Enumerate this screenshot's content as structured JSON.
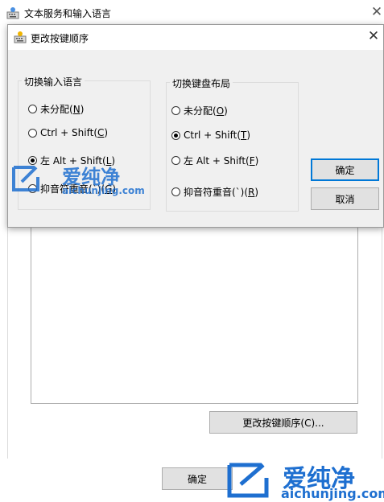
{
  "background_window": {
    "title": "文本服务和输入语言",
    "close_glyph": "✕",
    "change_sequence_button": "更改按键顺序(C)...",
    "ok_button": "确定"
  },
  "dialog": {
    "title": "更改按键顺序",
    "close_glyph": "✕",
    "input_language_group": {
      "title": "切换输入语言",
      "options": [
        {
          "label": "未分配",
          "key": "N",
          "checked": false
        },
        {
          "label": "Ctrl + Shift",
          "key": "C",
          "checked": false
        },
        {
          "label": "左 Alt + Shift",
          "key": "L",
          "checked": true
        },
        {
          "label": "抑音符重音(`)",
          "key": "G",
          "checked": false
        }
      ]
    },
    "keyboard_layout_group": {
      "title": "切换键盘布局",
      "options": [
        {
          "label": "未分配",
          "key": "O",
          "checked": false
        },
        {
          "label": "Ctrl + Shift",
          "key": "T",
          "checked": true
        },
        {
          "label": "左 Alt + Shift",
          "key": "F",
          "checked": false
        },
        {
          "label": "抑音符重音(`)",
          "key": "R",
          "checked": false
        }
      ]
    },
    "ok_button": "确定",
    "cancel_button": "取消"
  },
  "watermark": {
    "brand": "爱纯净",
    "domain": "aichunjing.com"
  },
  "colors": {
    "accent": "#0078d7",
    "watermark": "#1e6fd0"
  }
}
